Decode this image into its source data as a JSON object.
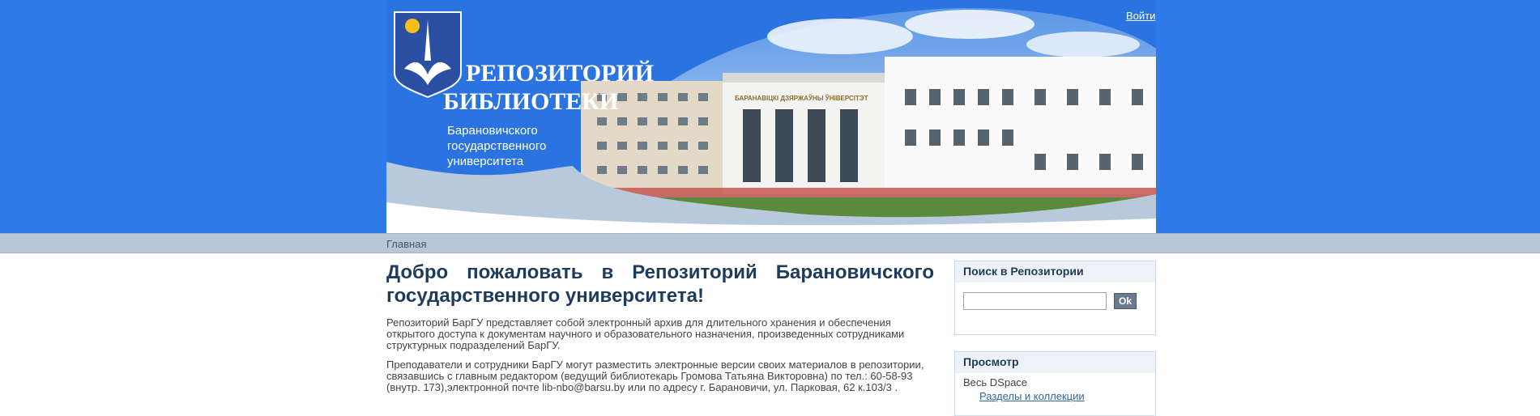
{
  "header": {
    "title_line1": "РЕПОЗИТОРИЙ",
    "title_line2": "БИБЛИОТЕКИ",
    "subtitle_line1": "Барановичского",
    "subtitle_line2": "государственного",
    "subtitle_line3": "университета",
    "building_sign": "БАРАНАВІЦКІ ДЗЯРЖАЎНЫ ЎНІВЕРСІТЭТ",
    "login": "Войти"
  },
  "breadcrumb": {
    "home": "Главная"
  },
  "main": {
    "heading": "Добро пожаловать в Репозиторий Барановичского государственного университета!",
    "para1": "Репозиторий БарГУ представляет собой электронный архив для длительного хранения и обеспечения открытого доступа к документам научного и образовательного назначения, произведенных сотрудниками структурных подразделений БарГУ.",
    "para2": "Преподаватели и сотрудники БарГУ могут разместить электронные версии своих материалов в репозитории, связавшись с главным редактором (ведущий библиотекарь Громова Татьяна Викторовна) по тел.: 60-58-93 (внутр. 173),электронной почте lib-nbo@barsu.by или по адресу г. Барановичи, ул. Парковая, 62 к.103/3 ."
  },
  "sidebar": {
    "search": {
      "title": "Поиск в Репозитории",
      "value": "",
      "button": "Ok"
    },
    "browse": {
      "title": "Просмотр",
      "scope": "Весь DSpace",
      "link1": "Разделы и коллекции"
    }
  },
  "colors": {
    "brand_blue": "#2e7ae8",
    "crumb_bar": "#b7c6d8",
    "heading": "#1f3b5c"
  }
}
